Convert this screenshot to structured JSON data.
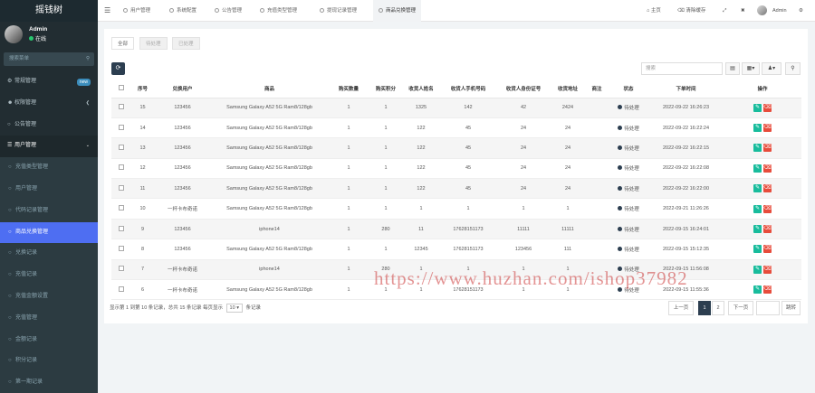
{
  "app": {
    "title": "摇钱树"
  },
  "user": {
    "name": "Admin",
    "status": "在线"
  },
  "sidebar": {
    "search_placeholder": "搜索菜单",
    "items": [
      {
        "label": "常规管理",
        "icon": "gear-icon",
        "badge": "new"
      },
      {
        "label": "权限管理",
        "icon": "group-icon"
      },
      {
        "label": "公告管理",
        "icon": "circle-icon"
      },
      {
        "label": "用户管理",
        "icon": "list-icon"
      },
      {
        "label": "充值类型管理"
      },
      {
        "label": "用户管理"
      },
      {
        "label": "代码记录管理"
      },
      {
        "label": "商品兑换管理"
      },
      {
        "label": "兑换记录"
      },
      {
        "label": "充值记录"
      },
      {
        "label": "充值金额设置"
      },
      {
        "label": "充值管理"
      },
      {
        "label": "金额记录"
      },
      {
        "label": "积分记录"
      },
      {
        "label": "第一期记录"
      }
    ]
  },
  "topbar": {
    "tabs": [
      "用户管理",
      "系统配置",
      "公告管理",
      "充值类型管理",
      "提现记录管理",
      "商品兑换管理"
    ],
    "home": "主页",
    "clear_cache": "清除缓存",
    "admin": "Admin"
  },
  "filters": [
    "全部",
    "待处理",
    "已处理"
  ],
  "toolbar": {
    "search_placeholder": "搜索"
  },
  "table": {
    "headers": [
      "序号",
      "兑换用户",
      "商品",
      "购买数量",
      "购买积分",
      "收货人姓名",
      "收货人手机号码",
      "收货人身份证号",
      "收货地址",
      "商注",
      "状态",
      "下单时间",
      "操作"
    ],
    "rows": [
      [
        "15",
        "123456",
        "Samsung Galaxy A52 5G Ram8/128gb",
        "1",
        "1",
        "1325",
        "142",
        "42",
        "2424",
        "",
        "待处理",
        "2022-09-22 16:26:23"
      ],
      [
        "14",
        "123456",
        "Samsung Galaxy A52 5G Ram8/128gb",
        "1",
        "1",
        "122",
        "45",
        "24",
        "24",
        "",
        "待处理",
        "2022-09-22 16:22:24"
      ],
      [
        "13",
        "123456",
        "Samsung Galaxy A52 5G Ram8/128gb",
        "1",
        "1",
        "122",
        "45",
        "24",
        "24",
        "",
        "待处理",
        "2022-09-22 16:22:15"
      ],
      [
        "12",
        "123456",
        "Samsung Galaxy A52 5G Ram8/128gb",
        "1",
        "1",
        "122",
        "45",
        "24",
        "24",
        "",
        "待处理",
        "2022-09-22 16:22:08"
      ],
      [
        "11",
        "123456",
        "Samsung Galaxy A52 5G Ram8/128gb",
        "1",
        "1",
        "122",
        "45",
        "24",
        "24",
        "",
        "待处理",
        "2022-09-22 16:22:00"
      ],
      [
        "10",
        "一杯卡布奇诺",
        "Samsung Galaxy A52 5G Ram8/128gb",
        "1",
        "1",
        "1",
        "1",
        "1",
        "1",
        "",
        "待处理",
        "2022-09-21 11:26:26"
      ],
      [
        "9",
        "123456",
        "iphone14",
        "1",
        "280",
        "11",
        "17628151173",
        "11111",
        "11111",
        "",
        "待处理",
        "2022-09-15 16:24:01"
      ],
      [
        "8",
        "123456",
        "Samsung Galaxy A52 5G Ram8/128gb",
        "1",
        "1",
        "12345",
        "17628151173",
        "123456",
        "111",
        "",
        "待处理",
        "2022-09-15 15:12:35"
      ],
      [
        "7",
        "一杯卡布奇诺",
        "iphone14",
        "1",
        "280",
        "1",
        "1",
        "1",
        "1",
        "",
        "待处理",
        "2022-09-15 11:56:08"
      ],
      [
        "6",
        "一杯卡布奇诺",
        "Samsung Galaxy A52 5G Ram8/128gb",
        "1",
        "1",
        "1",
        "17628151173",
        "1",
        "1",
        "",
        "待处理",
        "2022-09-15 11:55:36"
      ]
    ]
  },
  "pagination": {
    "info_prefix": "显示第 1 到第 10 条记录，总共 15 条记录 每页显示",
    "page_size": "10",
    "info_suffix": "条记录",
    "prev": "上一页",
    "pages": [
      "1",
      "2"
    ],
    "next": "下一页",
    "jump": "跳转"
  },
  "watermark": "https://www.huzhan.com/ishop37982"
}
